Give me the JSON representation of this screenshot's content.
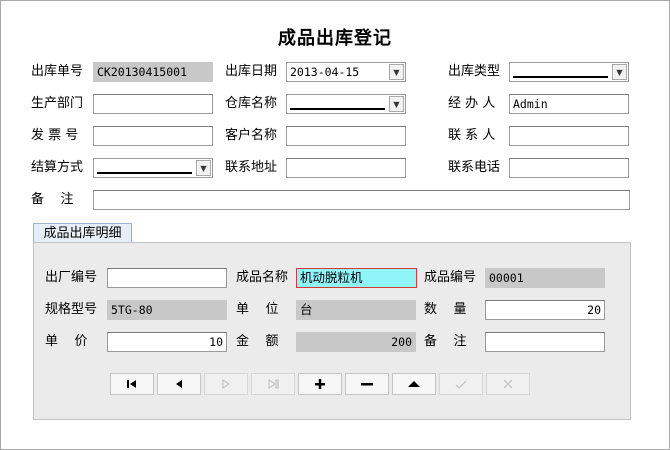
{
  "title": "成品出库登记",
  "form": {
    "out_no_label": "出库单号",
    "out_no": "CK20130415001",
    "out_date_label": "出库日期",
    "out_date": "2013-04-15",
    "out_type_label": "出库类型",
    "out_type": "",
    "dept_label": "生产部门",
    "dept": "",
    "warehouse_label": "仓库名称",
    "warehouse": "",
    "handler_label": "经 办 人",
    "handler": "Admin",
    "invoice_label": "发 票 号",
    "invoice": "",
    "customer_label": "客户名称",
    "customer": "",
    "contact_label": "联 系 人",
    "contact": "",
    "settle_label": "结算方式",
    "settle": "",
    "address_label": "联系地址",
    "address": "",
    "phone_label": "联系电话",
    "phone": "",
    "remark_label": "备    注",
    "remark": ""
  },
  "tab": {
    "label": "成品出库明细"
  },
  "detail": {
    "factory_no_label": "出厂编号",
    "factory_no": "",
    "product_name_label": "成品名称",
    "product_name": "机动脱粒机",
    "product_no_label": "成品编号",
    "product_no": "00001",
    "spec_label": "规格型号",
    "spec": "5TG-80",
    "unit_label": "单    位",
    "unit": "台",
    "qty_label": "数    量",
    "qty": "20",
    "price_label": "单    价",
    "price": "10",
    "amount_label": "金    额",
    "amount": "200",
    "remark_label": "备    注",
    "remark": ""
  },
  "navigator": {
    "buttons": [
      {
        "name": "first-record-button",
        "icon": "first-icon",
        "enabled": true
      },
      {
        "name": "prior-record-button",
        "icon": "prior-icon",
        "enabled": true
      },
      {
        "name": "next-record-button",
        "icon": "next-icon",
        "enabled": false
      },
      {
        "name": "last-record-button",
        "icon": "last-icon",
        "enabled": false
      },
      {
        "name": "insert-record-button",
        "icon": "plus-icon",
        "enabled": true
      },
      {
        "name": "delete-record-button",
        "icon": "minus-icon",
        "enabled": true
      },
      {
        "name": "edit-record-button",
        "icon": "up-triangle-icon",
        "enabled": true
      },
      {
        "name": "post-record-button",
        "icon": "check-icon",
        "enabled": false
      },
      {
        "name": "cancel-record-button",
        "icon": "x-icon",
        "enabled": false
      }
    ]
  },
  "colors": {
    "highlight_bg": "#8ff5f8",
    "highlight_border": "#d23a3a",
    "readonly_bg": "#c8c8c8",
    "panel_bg": "#ebebeb"
  }
}
